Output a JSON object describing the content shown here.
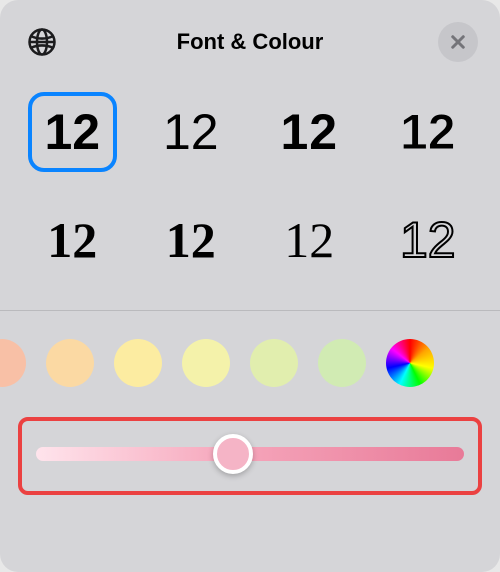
{
  "header": {
    "title": "Font & Colour",
    "globe_icon": "globe-icon",
    "close_icon": "close-icon"
  },
  "fonts": {
    "sample": "12",
    "selected_index": 0,
    "count": 8
  },
  "colors": {
    "swatches": [
      "#f8c0a6",
      "#fbd9a3",
      "#fceca1",
      "#f4f2aa",
      "#e1eeae",
      "#d1ebb3"
    ],
    "picker_icon": "rainbow-picker"
  },
  "tint_slider": {
    "value_percent": 46,
    "gradient_from": "#ffe4ec",
    "gradient_mid": "#f6a7bc",
    "gradient_to": "#e87a98",
    "thumb_color": "#f5b4c6",
    "highlight_color": "#eb4141"
  }
}
